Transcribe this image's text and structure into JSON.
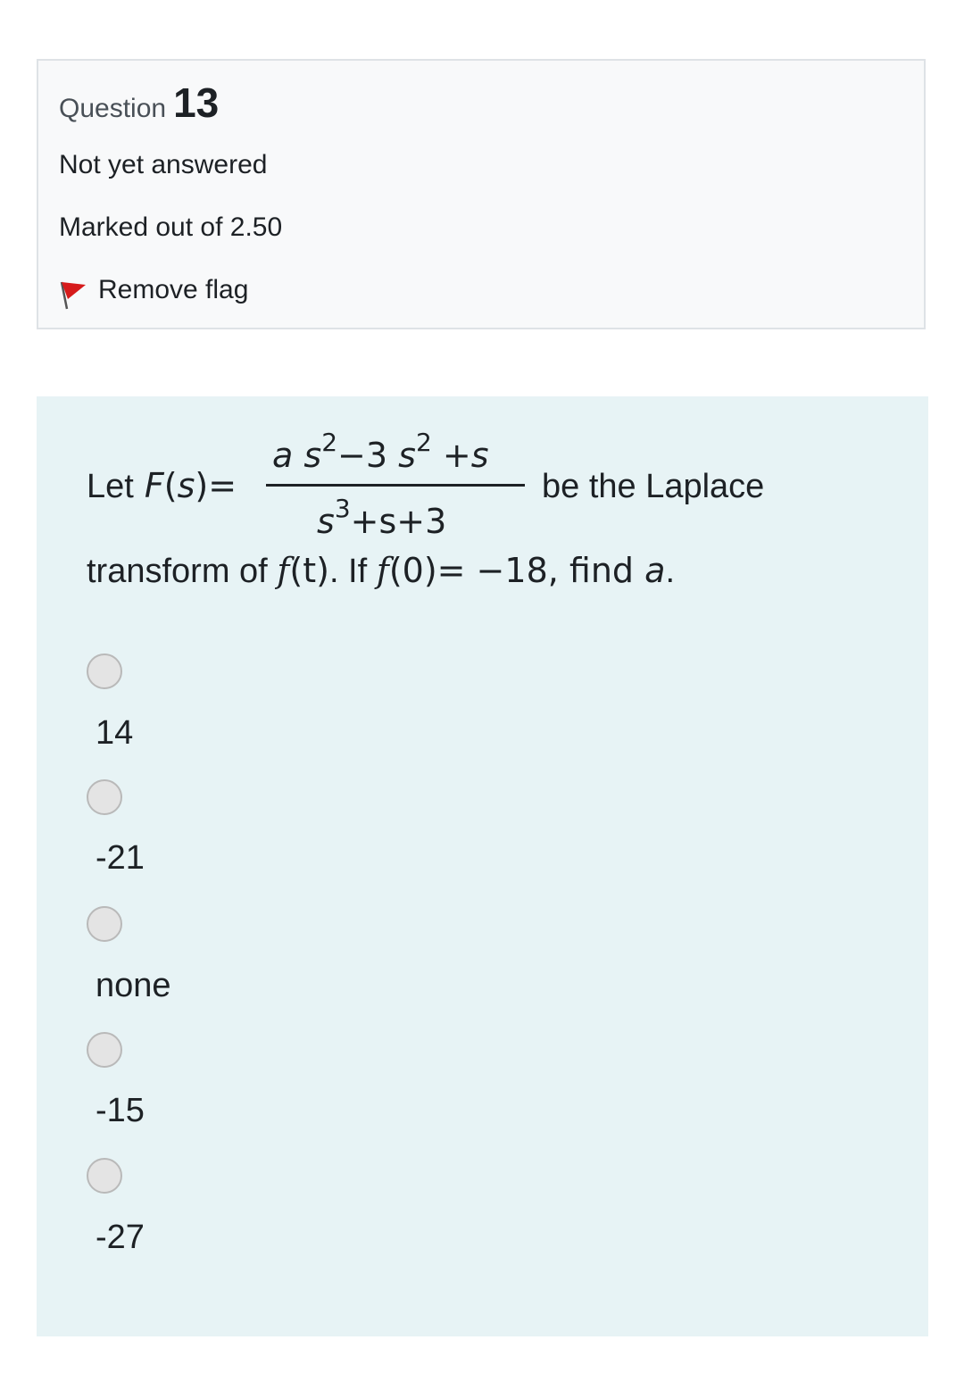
{
  "info": {
    "question_word": "Question",
    "question_number": "13",
    "state": "Not yet answered",
    "grade": "Marked out of 2.50",
    "flag_label": "Remove flag"
  },
  "question": {
    "let": "Let",
    "F": "F",
    "s": "s",
    "open_paren": "(",
    "close_paren": ")",
    "equals": "=",
    "numerator": {
      "a": "a",
      "s1": "s",
      "exp1": "2",
      "minus": "−3",
      "s2": "s",
      "exp2": "2",
      "plus": "+",
      "s3": "s"
    },
    "denominator": {
      "s": "s",
      "exp": "3",
      "rest": "+s+3"
    },
    "tail1": "be the Laplace",
    "line2_a": "transform of ",
    "f1": "f",
    "t_part": "(t)",
    "line2_b": ". If ",
    "f2": "f",
    "line2_c": "(0)= −18, find ",
    "a_end": "a",
    "period": "."
  },
  "options": [
    "14",
    "-21",
    "none",
    "-15",
    "-27"
  ],
  "colors": {
    "flag_red": "#d61b1b",
    "content_bg": "#e7f3f5",
    "info_bg": "#f8f9fa"
  }
}
